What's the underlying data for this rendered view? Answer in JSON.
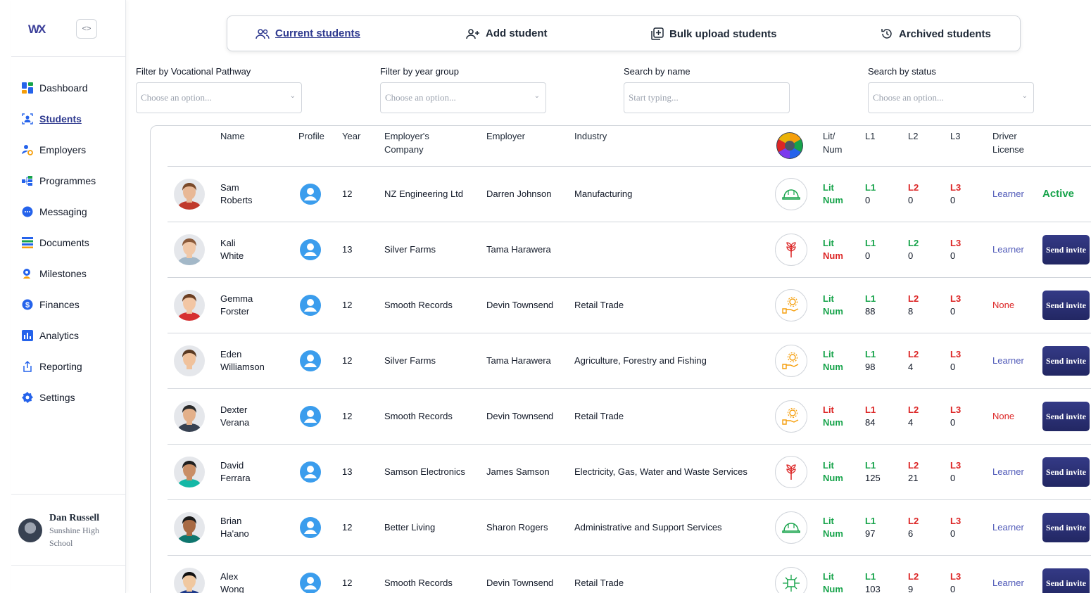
{
  "brand": {
    "logo_text": "WX",
    "collapse_label": "<>"
  },
  "sidebar": {
    "items": [
      {
        "label": "Dashboard",
        "icon": "dashboard-icon"
      },
      {
        "label": "Students",
        "icon": "students-icon",
        "active": true
      },
      {
        "label": "Employers",
        "icon": "employers-icon"
      },
      {
        "label": "Programmes",
        "icon": "programmes-icon"
      },
      {
        "label": "Messaging",
        "icon": "messaging-icon"
      },
      {
        "label": "Documents",
        "icon": "documents-icon"
      },
      {
        "label": "Milestones",
        "icon": "milestones-icon"
      },
      {
        "label": "Finances",
        "icon": "finances-icon"
      },
      {
        "label": "Analytics",
        "icon": "analytics-icon"
      },
      {
        "label": "Reporting",
        "icon": "reporting-icon"
      },
      {
        "label": "Settings",
        "icon": "settings-icon"
      }
    ],
    "user": {
      "name": "Dan Russell",
      "school": "Sunshine High School"
    }
  },
  "tabs": [
    {
      "label": "Current students",
      "icon": "users-icon",
      "active": true
    },
    {
      "label": "Add student",
      "icon": "user-plus-icon"
    },
    {
      "label": "Bulk upload students",
      "icon": "upload-icon"
    },
    {
      "label": "Archived students",
      "icon": "history-icon"
    }
  ],
  "filters": {
    "pathway": {
      "label": "Filter by Vocational Pathway",
      "placeholder": "Choose an option..."
    },
    "year": {
      "label": "Filter by year group",
      "placeholder": "Choose an option..."
    },
    "name": {
      "label": "Search by name",
      "placeholder": "Start typing..."
    },
    "status": {
      "label": "Search by status",
      "placeholder": "Choose an option..."
    }
  },
  "table": {
    "headers": {
      "name": "Name",
      "profile": "Profile",
      "year": "Year",
      "company_l1": "Employer's",
      "company_l2": "Company",
      "employer": "Employer",
      "industry": "Industry",
      "litnum_l1": "Lit/",
      "litnum_l2": "Num",
      "l1": "L1",
      "l2": "L2",
      "l3": "L3",
      "license_l1": "Driver",
      "license_l2": "License"
    },
    "rows": [
      {
        "first": "Sam",
        "last": "Roberts",
        "year": "12",
        "company": "NZ Engineering Ltd",
        "employer": "Darren Johnson",
        "industry": "Manufacturing",
        "pathway": "hardhat-icon",
        "pathway_color": "#16a34a",
        "lit": "Lit",
        "lit_ok": true,
        "num": "Num",
        "num_ok": true,
        "l1": "L1",
        "l1_val": "0",
        "l1_ok": true,
        "l2": "L2",
        "l2_val": "0",
        "l2_ok": false,
        "l3": "L3",
        "l3_val": "0",
        "l3_ok": false,
        "license": "Learner",
        "action": "Active",
        "skin": "#e8b896",
        "hair": "#7a4a2a",
        "shirt": "#c0392b"
      },
      {
        "first": "Kali",
        "last": "White",
        "year": "13",
        "company": "Silver Farms",
        "employer": "Tama Harawera",
        "industry": "",
        "pathway": "plant-icon",
        "pathway_color": "#dc2626",
        "lit": "Lit",
        "lit_ok": true,
        "num": "Num",
        "num_ok": false,
        "l1": "L1",
        "l1_val": "0",
        "l1_ok": true,
        "l2": "L2",
        "l2_val": "0",
        "l2_ok": true,
        "l3": "L3",
        "l3_val": "0",
        "l3_ok": false,
        "license": "Learner",
        "action": "Send invite",
        "skin": "#f0c8a8",
        "hair": "#8a5a3a",
        "shirt": "#a3b8c8"
      },
      {
        "first": "Gemma",
        "last": "Forster",
        "year": "12",
        "company": "Smooth Records",
        "employer": "Devin Townsend",
        "industry": "Retail Trade",
        "pathway": "service-icon",
        "pathway_color": "#f59e0b",
        "lit": "Lit",
        "lit_ok": true,
        "num": "Num",
        "num_ok": true,
        "l1": "L1",
        "l1_val": "88",
        "l1_ok": true,
        "l2": "L2",
        "l2_val": "8",
        "l2_ok": false,
        "l3": "L3",
        "l3_val": "0",
        "l3_ok": false,
        "license": "None",
        "action": "Send invite",
        "skin": "#f2c6a4",
        "hair": "#6b3e22",
        "shirt": "#d63031"
      },
      {
        "first": "Eden",
        "last": "Williamson",
        "year": "12",
        "company": "Silver Farms",
        "employer": "Tama Harawera",
        "industry": "Agriculture, Forestry and Fishing",
        "pathway": "service-icon",
        "pathway_color": "#f59e0b",
        "lit": "Lit",
        "lit_ok": true,
        "num": "Num",
        "num_ok": true,
        "l1": "L1",
        "l1_val": "98",
        "l1_ok": true,
        "l2": "L2",
        "l2_val": "4",
        "l2_ok": false,
        "l3": "L3",
        "l3_val": "0",
        "l3_ok": false,
        "license": "Learner",
        "action": "Send invite",
        "skin": "#f0c29c",
        "hair": "#5a3a22",
        "shirt": "#e5e7eb"
      },
      {
        "first": "Dexter",
        "last": "Verana",
        "year": "12",
        "company": "Smooth Records",
        "employer": "Devin Townsend",
        "industry": "Retail Trade",
        "pathway": "service-icon",
        "pathway_color": "#f59e0b",
        "lit": "Lit",
        "lit_ok": false,
        "num": "Num",
        "num_ok": true,
        "l1": "L1",
        "l1_val": "84",
        "l1_ok": false,
        "l2": "L2",
        "l2_val": "4",
        "l2_ok": false,
        "l3": "L3",
        "l3_val": "0",
        "l3_ok": false,
        "license": "None",
        "action": "Send invite",
        "skin": "#e3b08a",
        "hair": "#2b2b2b",
        "shirt": "#374151"
      },
      {
        "first": "David",
        "last": "Ferrara",
        "year": "13",
        "company": "Samson Electronics",
        "employer": "James Samson",
        "industry": "Electricity, Gas, Water and Waste Services",
        "pathway": "plant-icon",
        "pathway_color": "#dc2626",
        "lit": "Lit",
        "lit_ok": true,
        "num": "Num",
        "num_ok": true,
        "l1": "L1",
        "l1_val": "125",
        "l1_ok": true,
        "l2": "L2",
        "l2_val": "21",
        "l2_ok": false,
        "l3": "L3",
        "l3_val": "0",
        "l3_ok": false,
        "license": "Learner",
        "action": "Send invite",
        "skin": "#c98e66",
        "hair": "#1f1f1f",
        "shirt": "#14b8a6"
      },
      {
        "first": "Brian",
        "last": "Ha'ano",
        "year": "12",
        "company": "Better Living",
        "employer": "Sharon Rogers",
        "industry": "Administrative and Support Services",
        "pathway": "hardhat-icon",
        "pathway_color": "#16a34a",
        "lit": "Lit",
        "lit_ok": true,
        "num": "Num",
        "num_ok": true,
        "l1": "L1",
        "l1_val": "97",
        "l1_ok": true,
        "l2": "L2",
        "l2_val": "6",
        "l2_ok": false,
        "l3": "L3",
        "l3_val": "0",
        "l3_ok": false,
        "license": "Learner",
        "action": "Send invite",
        "skin": "#a86a44",
        "hair": "#1a1a1a",
        "shirt": "#0f766e"
      },
      {
        "first": "Alex",
        "last": "Wong",
        "year": "12",
        "company": "Smooth Records",
        "employer": "Devin Townsend",
        "industry": "Retail Trade",
        "pathway": "circuit-icon",
        "pathway_color": "#16a34a",
        "lit": "Lit",
        "lit_ok": true,
        "num": "Num",
        "num_ok": true,
        "l1": "L1",
        "l1_val": "103",
        "l1_ok": true,
        "l2": "L2",
        "l2_val": "9",
        "l2_ok": false,
        "l3": "L3",
        "l3_val": "0",
        "l3_ok": false,
        "license": "Learner",
        "action": "Send invite",
        "skin": "#f0c8a0",
        "hair": "#111111",
        "shirt": "#1e3a8a"
      }
    ]
  }
}
